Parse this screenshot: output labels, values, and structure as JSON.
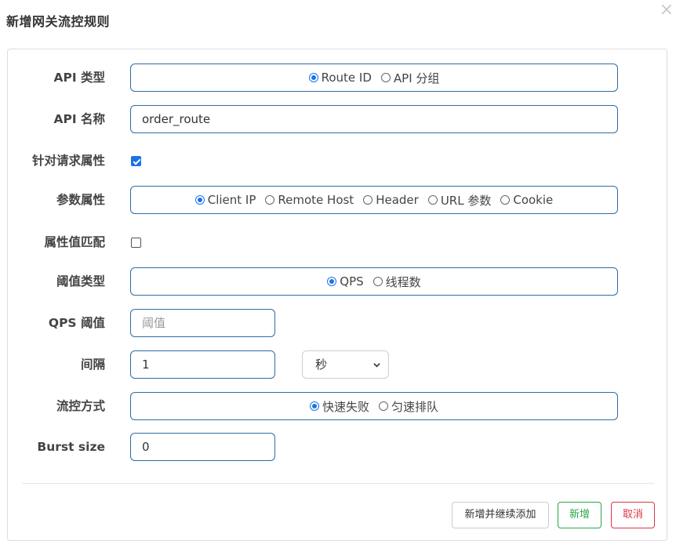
{
  "dialog": {
    "title": "新增网关流控规则",
    "close_symbol": "×"
  },
  "form": {
    "api_type": {
      "label": "API 类型",
      "options": [
        {
          "label": "Route ID",
          "selected": true
        },
        {
          "label": "API 分组",
          "selected": false
        }
      ]
    },
    "api_name": {
      "label": "API 名称",
      "value": "order_route"
    },
    "request_attr": {
      "label": "针对请求属性",
      "checked": true
    },
    "param_attr": {
      "label": "参数属性",
      "options": [
        {
          "label": "Client IP",
          "selected": true
        },
        {
          "label": "Remote Host",
          "selected": false
        },
        {
          "label": "Header",
          "selected": false
        },
        {
          "label": "URL 参数",
          "selected": false
        },
        {
          "label": "Cookie",
          "selected": false
        }
      ]
    },
    "attr_match": {
      "label": "属性值匹配",
      "checked": false
    },
    "threshold_type": {
      "label": "阈值类型",
      "options": [
        {
          "label": "QPS",
          "selected": true
        },
        {
          "label": "线程数",
          "selected": false
        }
      ]
    },
    "qps_threshold": {
      "label": "QPS 阈值",
      "placeholder": "阈值",
      "value": ""
    },
    "interval": {
      "label": "间隔",
      "value": "1",
      "unit": "秒"
    },
    "control_mode": {
      "label": "流控方式",
      "options": [
        {
          "label": "快速失败",
          "selected": true
        },
        {
          "label": "匀速排队",
          "selected": false
        }
      ]
    },
    "burst_size": {
      "label": "Burst size",
      "value": "0"
    }
  },
  "footer": {
    "add_continue_label": "新增并继续添加",
    "add_label": "新增",
    "cancel_label": "取消"
  },
  "colors": {
    "primary": "#1a73e8",
    "input_border": "#2e6da4",
    "success": "#28a745",
    "danger": "#dc3545"
  }
}
